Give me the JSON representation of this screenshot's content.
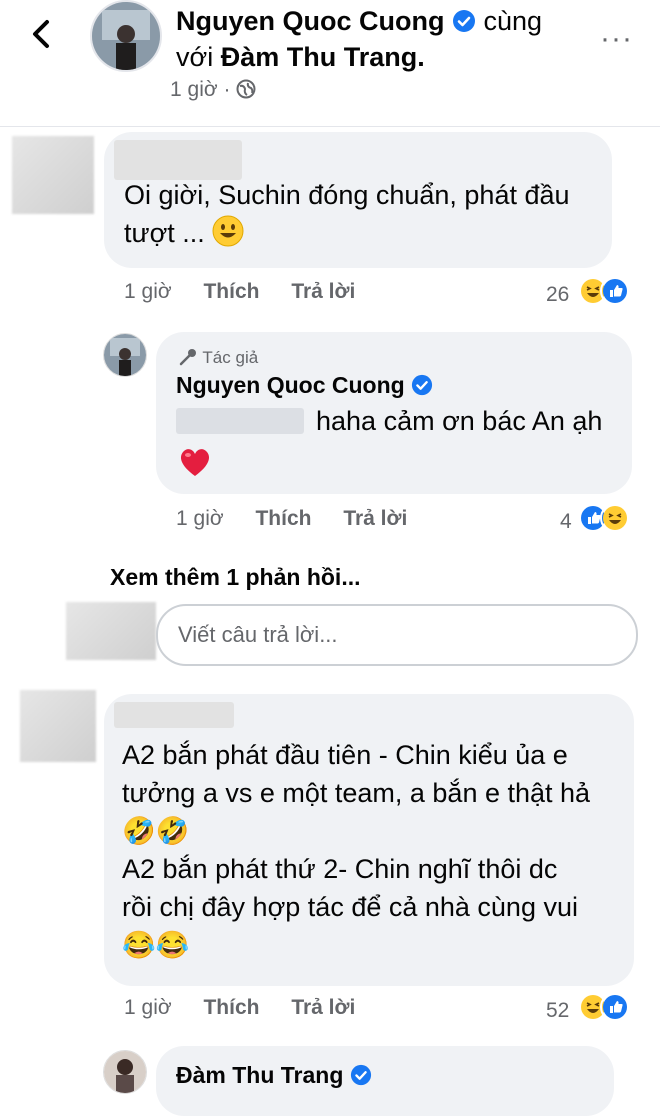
{
  "header": {
    "author": "Nguyen Quoc Cuong",
    "with_word": "cùng",
    "with_prefix": "với",
    "tagged": "Đàm Thu Trang.",
    "time": "1 giờ ·",
    "more": "···"
  },
  "comments": [
    {
      "text_line1": "Oi giời, Suchin đóng chuẩn, phát đầu",
      "text_line2": "tượt ...",
      "time": "1 giờ",
      "like_label": "Thích",
      "reply_label": "Trả lời",
      "reactions": "26"
    },
    {
      "author_badge": "Tác giả",
      "author": "Nguyen Quoc Cuong",
      "text": "haha cảm ơn bác An ạh",
      "heart": "❤️",
      "time": "1 giờ",
      "like_label": "Thích",
      "reply_label": "Trả lời",
      "reactions": "4"
    },
    {
      "line1": "A2 bắn phát đầu tiên - Chin kiểu ủa e",
      "line2": "tưởng a vs e một team, a bắn e thật hả",
      "emoji_row1": "🤣🤣",
      "line3": "A2 bắn phát thứ 2- Chin nghĩ thôi dc",
      "line4": "rồi chị đây hợp tác để cả nhà cùng vui",
      "emoji_row2": "😂😂",
      "time": "1 giờ",
      "like_label": "Thích",
      "reply_label": "Trả lời",
      "reactions": "52"
    },
    {
      "author": "Đàm Thu Trang"
    }
  ],
  "more_replies": "Xem thêm 1 phản hồi...",
  "reply_input": {
    "placeholder": "Viết câu trả lời..."
  },
  "colors": {
    "bubble": "#f0f2f5",
    "verified": "#1877f2",
    "meta": "#65676b"
  }
}
